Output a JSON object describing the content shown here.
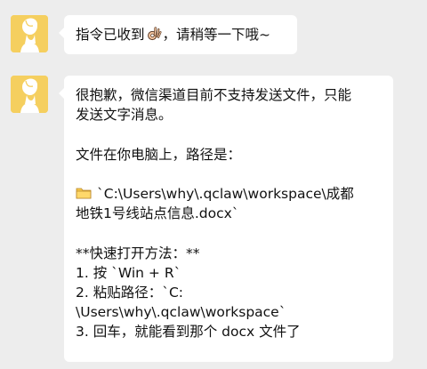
{
  "messages": [
    {
      "text_before": "指令已收到",
      "emoji": "ok-hand-icon",
      "text_after": "，请稍等一下哦~"
    },
    {
      "lines": {
        "l1": "很抱歉，微信渠道目前不支持发送文件，只能",
        "l2": "发送文字消息。",
        "l3": "文件在你电脑上，路径是：",
        "l4_icon": "folder-icon",
        "l4": "`C:\\Users\\why\\.qclaw\\workspace\\成都",
        "l5": "地铁1号线站点信息.docx`",
        "l6": "**快速打开方法：**",
        "l7": "1. 按 `Win + R`",
        "l8": "2. 粘贴路径：`C:",
        "l9": "\\Users\\why\\.qclaw\\workspace`",
        "l10": "3. 回车，就能看到那个 docx 文件了"
      }
    }
  ],
  "colors": {
    "background": "#ededed",
    "bubble": "#ffffff",
    "avatar": "#f5cf5f",
    "text": "#111111"
  }
}
